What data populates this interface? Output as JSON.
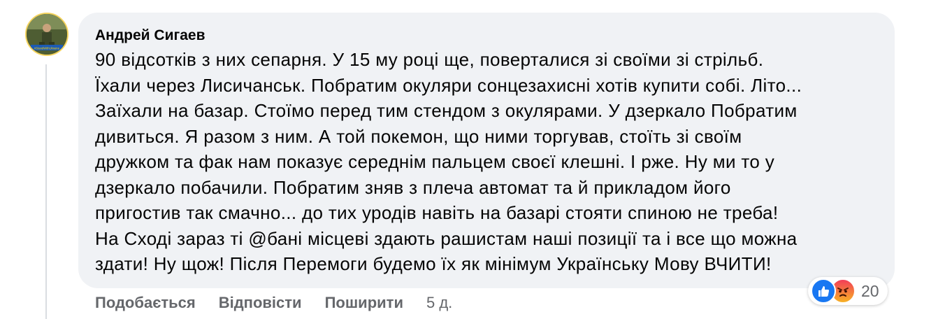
{
  "comment": {
    "author": "Андрей Сигаев",
    "avatar_badge": "#StandWithUkraine",
    "text_lines": [
      "90 відсотків з них сепарня. У 15 му році ще, поверталися зі своїми зі стрільб.",
      "Їхали через Лисичанськ. Побратим окуляри сонцезахисні хотів купити собі. Літо...",
      "Заїхали на базар. Стоїмо перед тим стендом з окулярами. У дзеркало Побратим",
      "дивиться. Я разом з ним. А той покемон, що ними торгував, стоїть зі своїм",
      "дружком та фак нам показує середнім пальцем своєї клешні. І рже. Ну ми то у",
      "дзеркало побачили. Побратим зняв з плеча автомат та й прикладом його",
      "пригостив так смачно... до тих уродів навіть на базарі стояти спиною не треба!",
      "На Сході зараз ті @бані місцеві здають рашистам наші позиції та і все що можна",
      "здати! Ну щож! Після Перемоги будемо їх як мінімум Українську Мову ВЧИТИ!"
    ]
  },
  "actions": {
    "like": "Подобається",
    "reply": "Відповісти",
    "share": "Поширити",
    "time": "5 д."
  },
  "reactions": {
    "icons": [
      "like-icon",
      "angry-icon"
    ],
    "count": "20",
    "colors": {
      "like": "#1877f2",
      "angry": "#f5683a"
    }
  },
  "theme": {
    "bubble_bg": "#f0f2f5",
    "text": "#050505",
    "secondary": "#65676b"
  }
}
